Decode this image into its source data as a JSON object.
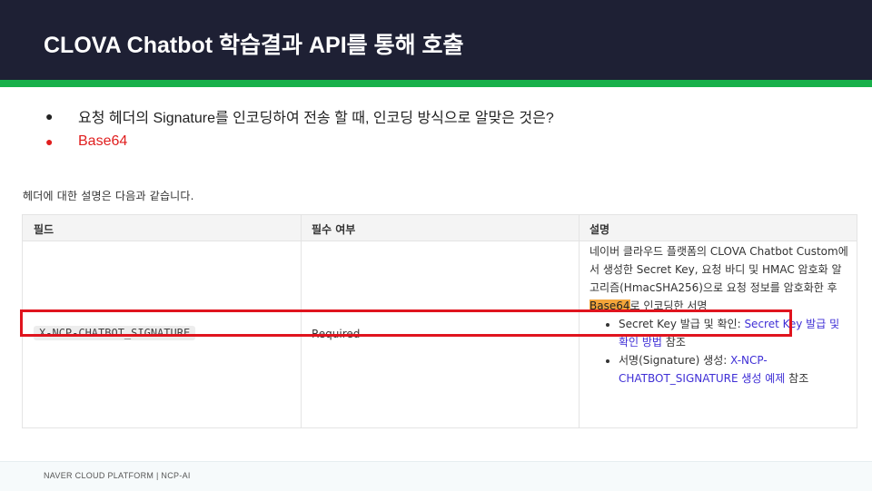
{
  "slide": {
    "title": "CLOVA Chatbot  학습결과 API를 통해 호출",
    "bullets": [
      {
        "text": "요청 헤더의 Signature를 인코딩하여 전송 할 때, 인코딩 방식으로 알맞은 것은?"
      },
      {
        "text": "Base64"
      }
    ],
    "footer": "NAVER CLOUD PLATFORM  |  NCP-AI"
  },
  "doc": {
    "caption": "헤더에 대한 설명은 다음과 같습니다.",
    "columns": [
      "필드",
      "필수 여부",
      "설명"
    ],
    "field": "X-NCP-CHATBOT_SIGNATURE",
    "required": "Required",
    "desc_pre": "네이버 클라우드 플랫폼의 CLOVA Chatbot Custom에서 생성한 Secret Key, 요청 바디 및 HMAC 암호화 알고리즘(HmacSHA256)으로 요청 정보를 암호화한 후 ",
    "desc_highlight": "Base64",
    "desc_post": "로 인코딩한 서명",
    "sub1_pre": "Secret Key 발급 및 확인: ",
    "sub1_link": "Secret Key 발급 및 확인 방법",
    "sub1_post": " 참조",
    "sub2_pre": "서명(Signature) 생성: ",
    "sub2_link": "X-NCP-CHATBOT_SIGNATURE 생성 예제",
    "sub2_post": " 참조"
  },
  "colors": {
    "titlebar": "#1e2034",
    "accent": "#18b04a",
    "answer": "#e01e1e",
    "highlight": "#f3a53a",
    "link": "#3f2fd6",
    "annotation_box": "#e0141e"
  }
}
